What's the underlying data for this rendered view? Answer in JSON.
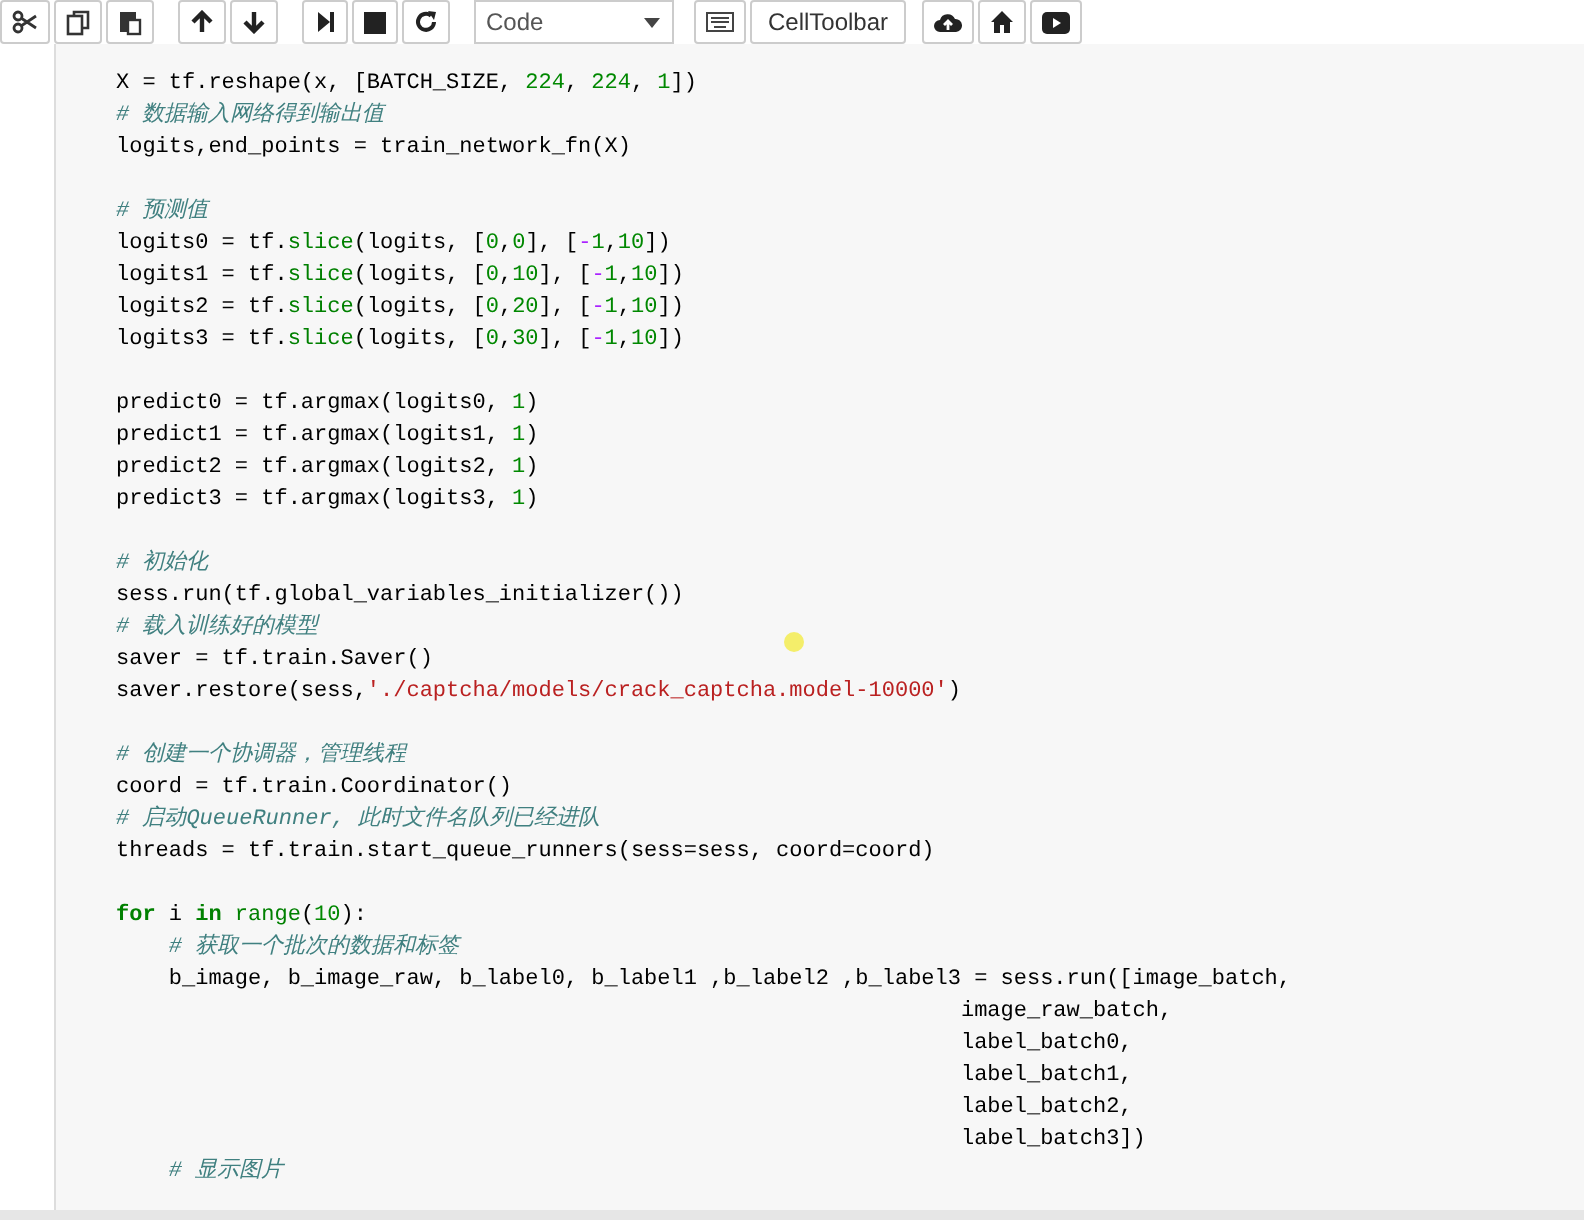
{
  "toolbar": {
    "button_groups": [
      [
        {
          "kind": "cut"
        },
        {
          "kind": "copy"
        },
        {
          "kind": "paste"
        }
      ],
      [
        {
          "kind": "up"
        },
        {
          "kind": "down"
        }
      ],
      [
        {
          "kind": "step"
        },
        {
          "kind": "stop"
        },
        {
          "kind": "restart"
        }
      ]
    ],
    "cell_type": "Code",
    "extra": [
      {
        "kind": "keyboard"
      },
      {
        "kind": "text",
        "label": "CellToolbar"
      },
      {
        "kind": "upload"
      },
      {
        "kind": "home"
      },
      {
        "kind": "play"
      }
    ]
  },
  "code_blocks": [
    {
      "lines": [
        [
          {
            "kind": "plain",
            "text": "X = tf.reshape(x, [BATCH_SIZE, "
          },
          {
            "kind": "number",
            "text": "224"
          },
          {
            "kind": "plain",
            "text": ", "
          },
          {
            "kind": "number",
            "text": "224"
          },
          {
            "kind": "plain",
            "text": ", "
          },
          {
            "kind": "number",
            "text": "1"
          },
          {
            "kind": "plain",
            "text": "])"
          }
        ],
        [
          {
            "kind": "comment",
            "text": "# 数据输入网络得到输出值"
          }
        ],
        [
          {
            "kind": "plain",
            "text": "logits,end_points = train_network_fn(X)"
          }
        ]
      ]
    },
    {
      "lines": [
        [
          {
            "kind": "comment",
            "text": "# 预测值"
          }
        ],
        [
          {
            "kind": "plain",
            "text": "logits0 = tf."
          },
          {
            "kind": "builtin",
            "text": "slice"
          },
          {
            "kind": "plain",
            "text": "(logits, ["
          },
          {
            "kind": "number",
            "text": "0"
          },
          {
            "kind": "plain",
            "text": ","
          },
          {
            "kind": "number",
            "text": "0"
          },
          {
            "kind": "plain",
            "text": "], ["
          },
          {
            "kind": "operator",
            "text": "-"
          },
          {
            "kind": "number",
            "text": "1"
          },
          {
            "kind": "plain",
            "text": ","
          },
          {
            "kind": "number",
            "text": "10"
          },
          {
            "kind": "plain",
            "text": "])"
          }
        ],
        [
          {
            "kind": "plain",
            "text": "logits1 = tf."
          },
          {
            "kind": "builtin",
            "text": "slice"
          },
          {
            "kind": "plain",
            "text": "(logits, ["
          },
          {
            "kind": "number",
            "text": "0"
          },
          {
            "kind": "plain",
            "text": ","
          },
          {
            "kind": "number",
            "text": "10"
          },
          {
            "kind": "plain",
            "text": "], ["
          },
          {
            "kind": "operator",
            "text": "-"
          },
          {
            "kind": "number",
            "text": "1"
          },
          {
            "kind": "plain",
            "text": ","
          },
          {
            "kind": "number",
            "text": "10"
          },
          {
            "kind": "plain",
            "text": "])"
          }
        ],
        [
          {
            "kind": "plain",
            "text": "logits2 = tf."
          },
          {
            "kind": "builtin",
            "text": "slice"
          },
          {
            "kind": "plain",
            "text": "(logits, ["
          },
          {
            "kind": "number",
            "text": "0"
          },
          {
            "kind": "plain",
            "text": ","
          },
          {
            "kind": "number",
            "text": "20"
          },
          {
            "kind": "plain",
            "text": "], ["
          },
          {
            "kind": "operator",
            "text": "-"
          },
          {
            "kind": "number",
            "text": "1"
          },
          {
            "kind": "plain",
            "text": ","
          },
          {
            "kind": "number",
            "text": "10"
          },
          {
            "kind": "plain",
            "text": "])"
          }
        ],
        [
          {
            "kind": "plain",
            "text": "logits3 = tf."
          },
          {
            "kind": "builtin",
            "text": "slice"
          },
          {
            "kind": "plain",
            "text": "(logits, ["
          },
          {
            "kind": "number",
            "text": "0"
          },
          {
            "kind": "plain",
            "text": ","
          },
          {
            "kind": "number",
            "text": "30"
          },
          {
            "kind": "plain",
            "text": "], ["
          },
          {
            "kind": "operator",
            "text": "-"
          },
          {
            "kind": "number",
            "text": "1"
          },
          {
            "kind": "plain",
            "text": ","
          },
          {
            "kind": "number",
            "text": "10"
          },
          {
            "kind": "plain",
            "text": "])"
          }
        ]
      ]
    },
    {
      "lines": [
        [
          {
            "kind": "plain",
            "text": "predict0 = tf.argmax(logits0, "
          },
          {
            "kind": "number",
            "text": "1"
          },
          {
            "kind": "plain",
            "text": ")"
          }
        ],
        [
          {
            "kind": "plain",
            "text": "predict1 = tf.argmax(logits1, "
          },
          {
            "kind": "number",
            "text": "1"
          },
          {
            "kind": "plain",
            "text": ")"
          }
        ],
        [
          {
            "kind": "plain",
            "text": "predict2 = tf.argmax(logits2, "
          },
          {
            "kind": "number",
            "text": "1"
          },
          {
            "kind": "plain",
            "text": ")"
          }
        ],
        [
          {
            "kind": "plain",
            "text": "predict3 = tf.argmax(logits3, "
          },
          {
            "kind": "number",
            "text": "1"
          },
          {
            "kind": "plain",
            "text": ")"
          }
        ]
      ]
    },
    {
      "lines": [
        [
          {
            "kind": "comment",
            "text": "# 初始化"
          }
        ],
        [
          {
            "kind": "plain",
            "text": "sess.run(tf.global_variables_initializer())"
          }
        ],
        [
          {
            "kind": "comment",
            "text": "# 载入训练好的模型"
          }
        ],
        [
          {
            "kind": "plain",
            "text": "saver = tf.train.Saver()"
          }
        ],
        [
          {
            "kind": "plain",
            "text": "saver.restore(sess,"
          },
          {
            "kind": "string",
            "text": "'./captcha/models/crack_captcha.model-10000'"
          },
          {
            "kind": "plain",
            "text": ")"
          }
        ]
      ]
    },
    {
      "lines": [
        [
          {
            "kind": "comment",
            "text": "# 创建一个协调器，管理线程"
          }
        ],
        [
          {
            "kind": "plain",
            "text": "coord = tf.train.Coordinator()"
          }
        ],
        [
          {
            "kind": "comment",
            "text": "# 启动QueueRunner, 此时文件名队列已经进队"
          }
        ],
        [
          {
            "kind": "plain",
            "text": "threads = tf.train.start_queue_runners(sess=sess, coord=coord)"
          }
        ]
      ]
    },
    {
      "lines": [
        [
          {
            "kind": "keyword",
            "text": "for"
          },
          {
            "kind": "plain",
            "text": " i "
          },
          {
            "kind": "keyword",
            "text": "in"
          },
          {
            "kind": "builtin",
            "text": " range"
          },
          {
            "kind": "plain",
            "text": "("
          },
          {
            "kind": "number",
            "text": "10"
          },
          {
            "kind": "plain",
            "text": "):"
          }
        ],
        [
          {
            "kind": "comment",
            "text": "    # 获取一个批次的数据和标签"
          }
        ],
        [
          {
            "kind": "plain",
            "text": "    b_image, b_image_raw, b_label0, b_label1 ,b_label2 ,b_label3 = sess.run([image_batch,"
          }
        ],
        [
          {
            "kind": "plain",
            "text": "                                                                image_raw_batch,"
          }
        ],
        [
          {
            "kind": "plain",
            "text": "                                                                label_batch0,"
          }
        ],
        [
          {
            "kind": "plain",
            "text": "                                                                label_batch1,"
          }
        ],
        [
          {
            "kind": "plain",
            "text": "                                                                label_batch2,"
          }
        ],
        [
          {
            "kind": "plain",
            "text": "                                                                label_batch3])"
          }
        ],
        [
          {
            "kind": "comment",
            "text": "    # 显示图片"
          }
        ]
      ]
    }
  ]
}
